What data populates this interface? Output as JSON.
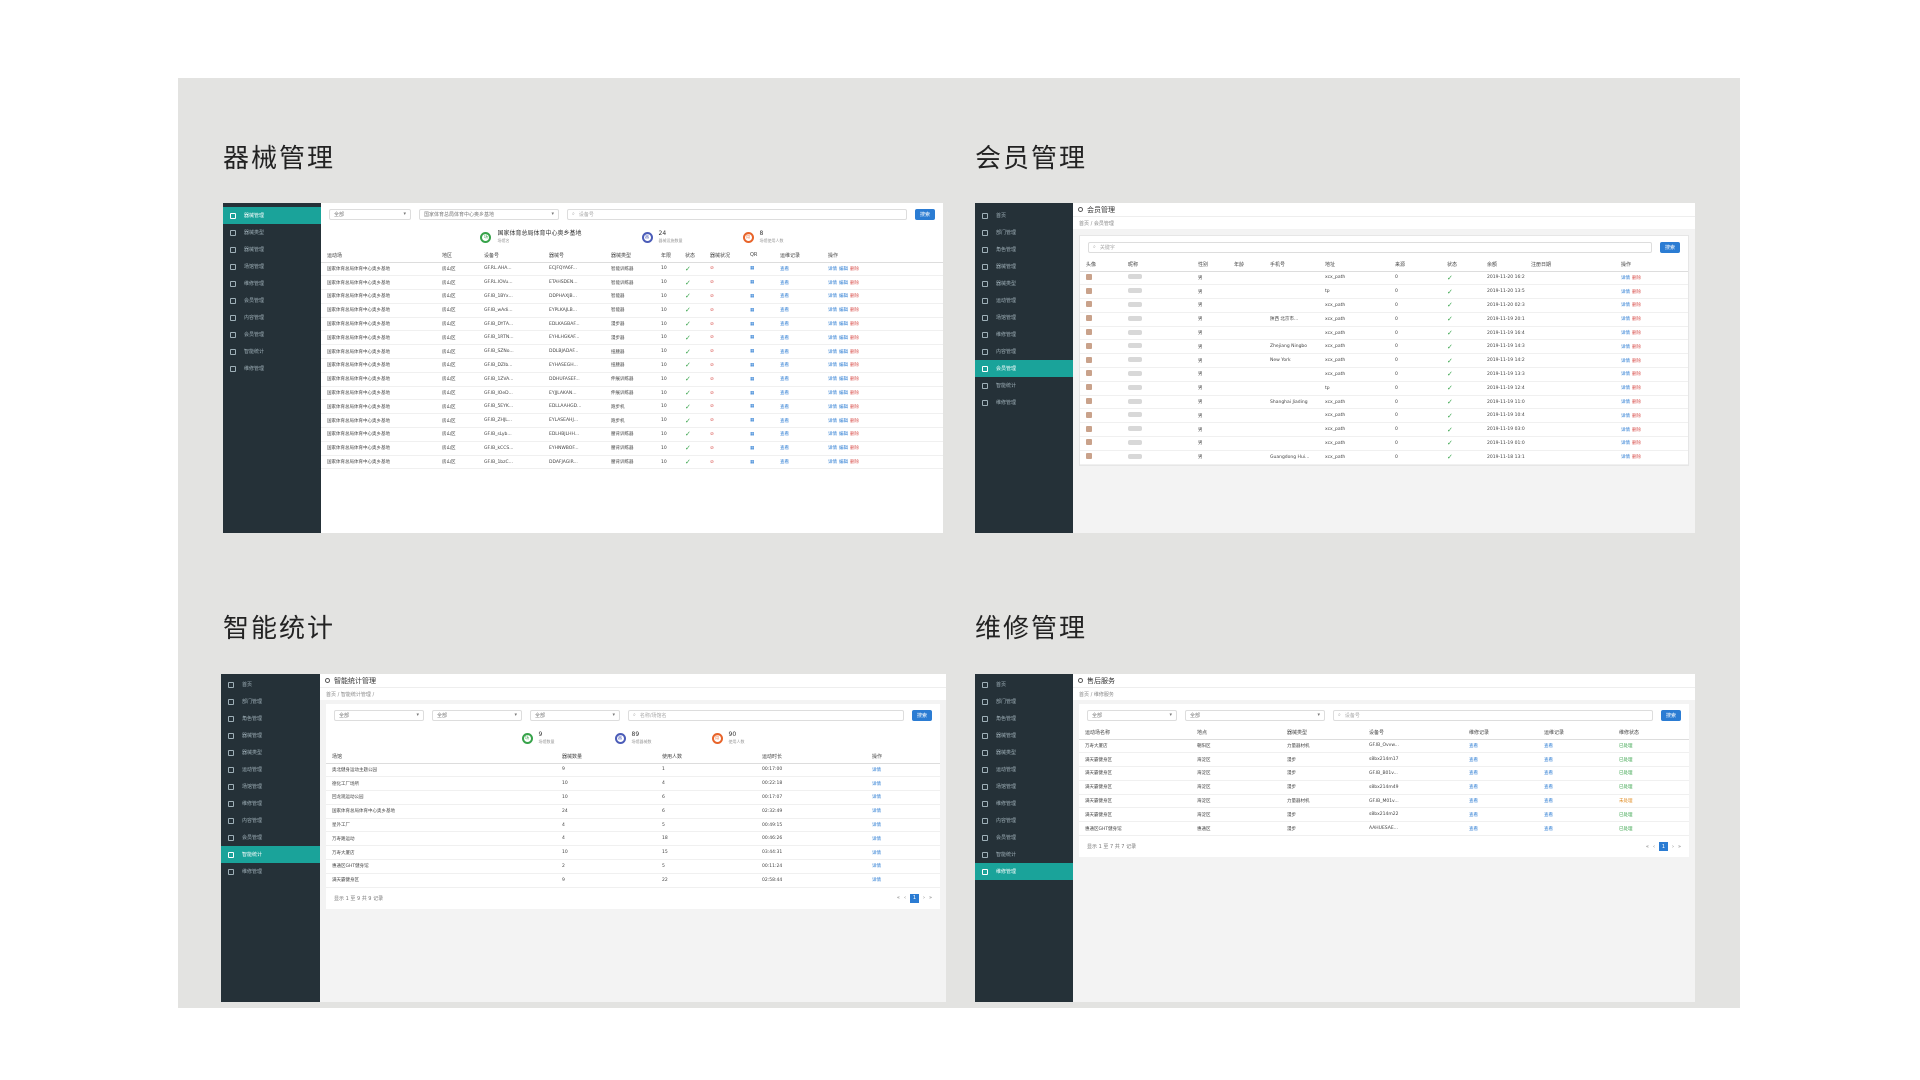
{
  "sections": {
    "equipment": {
      "title": "器械管理"
    },
    "member": {
      "title": "会员管理"
    },
    "stats": {
      "title": "智能统计"
    },
    "repair": {
      "title": "维修管理"
    }
  },
  "equipment": {
    "sidebar": [
      "器械管理",
      "器械类型",
      "器械管理",
      "场馆管理",
      "维修管理",
      "会员管理",
      "内容管理",
      "会员管理",
      "智能统计",
      "维修管理"
    ],
    "filter1": "全部",
    "filter2": "国家体育总局体育中心奥乡基地",
    "search_placeholder": "设备号",
    "search_btn": "搜索",
    "stat1": {
      "icon": "场",
      "value": "国家体育总局体育中心奥乡基地",
      "label": "场馆名"
    },
    "stat2": {
      "icon": "器",
      "value": "24",
      "label": "器械设施数量"
    },
    "stat3": {
      "icon": "用",
      "value": "8",
      "label": "场馆使用人数"
    },
    "columns": [
      "运动场",
      "地区",
      "设备号",
      "器械号",
      "器械类型",
      "年限",
      "状态",
      "器械状况",
      "QR",
      "运维记录",
      "操作"
    ],
    "rows": [
      [
        "国家体育总局体育中心奥乡基地",
        "房山区",
        "GF.RL.AHA...",
        "ECJFQYA6F...",
        "智能训练器",
        "10"
      ],
      [
        "国家体育总局体育中心奥乡基地",
        "房山区",
        "GF.RL.IOVu...",
        "ETAHSDEN...",
        "智能训练器",
        "10"
      ],
      [
        "国家体育总局体育中心奥乡基地",
        "房山区",
        "GF.IB_1BYx...",
        "DDPHAXJB...",
        "智能器",
        "10"
      ],
      [
        "国家体育总局体育中心奥乡基地",
        "房山区",
        "GF.IB_wAdi...",
        "EYPLKAJLB...",
        "智能器",
        "10"
      ],
      [
        "国家体育总局体育中心奥乡基地",
        "房山区",
        "GF.IB_DYTA...",
        "EDLKAGBAF...",
        "漫步器",
        "10"
      ],
      [
        "国家体育总局体育中心奥乡基地",
        "房山区",
        "GF.IB_1RTN...",
        "EYHLHGKAF...",
        "漫步器",
        "10"
      ],
      [
        "国家体育总局体育中心奥乡基地",
        "房山区",
        "GF.IB_SZNo...",
        "DDLBJADAF...",
        "扭腰器",
        "10"
      ],
      [
        "国家体育总局体育中心奥乡基地",
        "房山区",
        "GF.IB_DZIb...",
        "EYHASEGH...",
        "扭腰器",
        "10"
      ],
      [
        "国家体育总局体育中心奥乡基地",
        "房山区",
        "GF.IB_1ZVA...",
        "DDHUFASEF...",
        "伸展训练器",
        "10"
      ],
      [
        "国家体育总局体育中心奥乡基地",
        "房山区",
        "GF.IB_IOeD...",
        "EYJJLAKAN...",
        "伸展训练器",
        "10"
      ],
      [
        "国家体育总局体育中心奥乡基地",
        "房山区",
        "GF.IB_5EYK...",
        "EDLLAAHGD...",
        "跑步机",
        "10"
      ],
      [
        "国家体育总局体育中心奥乡基地",
        "房山区",
        "GF.IB_ZHJL...",
        "EYLASEAHJ...",
        "跑步机",
        "10"
      ],
      [
        "国家体育总局体育中心奥乡基地",
        "房山区",
        "GF.IB_sLyb...",
        "EDLHBJLHH...",
        "腰背训练器",
        "10"
      ],
      [
        "国家体育总局体育中心奥乡基地",
        "房山区",
        "GF.IB_kCCS...",
        "EYHNWBOF...",
        "腰背训练器",
        "10"
      ],
      [
        "国家体育总局体育中心奥乡基地",
        "房山区",
        "GF.IB_1bzC...",
        "DDAFJAGIR...",
        "腰背训练器",
        "10"
      ]
    ],
    "view": "查看",
    "ops": [
      "详情",
      "编辑",
      "删除"
    ]
  },
  "member": {
    "sidebar": [
      "首页",
      "部门管理",
      "角色管理",
      "器械管理",
      "器械类型",
      "运动管理",
      "场馆管理",
      "维修管理",
      "内容管理",
      "会员管理",
      "智能统计",
      "维修管理"
    ],
    "title": "会员管理",
    "crumb": "首页 / 会员管理",
    "search_placeholder": "关键字",
    "search_btn": "搜索",
    "columns": [
      "头像",
      "昵称",
      "性别",
      "年龄",
      "手机号",
      "地址",
      "来源",
      "状态",
      "余额",
      "注册日期",
      "操作"
    ],
    "rows": [
      [
        "男",
        "",
        "",
        "xcx_path",
        "0",
        "2019-11-20 16:23:53"
      ],
      [
        "男",
        "",
        "",
        "tp",
        "0",
        "2019-11-20 13:50:01"
      ],
      [
        "男",
        "",
        "",
        "xcx_path",
        "0",
        "2019-11-20 02:34:27"
      ],
      [
        "男",
        "",
        "陕西 北京市...",
        "xcx_path",
        "0",
        "2019-11-19 20:17:06"
      ],
      [
        "男",
        "",
        "",
        "xcx_path",
        "0",
        "2019-11-19 16:47:44"
      ],
      [
        "男",
        "",
        "Zhejiang Ningbo",
        "xcx_path",
        "0",
        "2019-11-19 14:36:53"
      ],
      [
        "男",
        "",
        "New York",
        "xcx_path",
        "0",
        "2019-11-19 14:28:51"
      ],
      [
        "男",
        "",
        "",
        "xcx_path",
        "0",
        "2019-11-19 13:34:45"
      ],
      [
        "男",
        "",
        "",
        "tp",
        "0",
        "2019-11-19 12:49:20"
      ],
      [
        "男",
        "",
        "Shanghai Jiading",
        "xcx_path",
        "0",
        "2019-11-19 11:02:37"
      ],
      [
        "男",
        "",
        "",
        "xcx_path",
        "0",
        "2019-11-19 10:40:07"
      ],
      [
        "男",
        "",
        "",
        "xcx_path",
        "0",
        "2019-11-19 03:02:00"
      ],
      [
        "男",
        "",
        "",
        "xcx_path",
        "0",
        "2019-11-19 01:03:23"
      ],
      [
        "男",
        "",
        "Guangdong Hui...",
        "xcx_path",
        "0",
        "2019-11-18 13:13:56"
      ]
    ],
    "ops": [
      "详情",
      "删除"
    ]
  },
  "stats": {
    "sidebar": [
      "首页",
      "部门管理",
      "角色管理",
      "器械管理",
      "器械类型",
      "运动管理",
      "场馆管理",
      "维修管理",
      "内容管理",
      "会员管理",
      "智能统计",
      "维修管理"
    ],
    "title": "智能统计管理",
    "crumb": "首页 / 智能统计管理 /",
    "filters": [
      "全部",
      "全部",
      "全部"
    ],
    "search_placeholder": "名称/场馆名",
    "search_btn": "搜索",
    "stat1": {
      "icon": "场",
      "value": "9",
      "label": "场馆数量"
    },
    "stat2": {
      "icon": "器",
      "value": "89",
      "label": "场馆器械数"
    },
    "stat3": {
      "icon": "用",
      "value": "90",
      "label": "使用人数"
    },
    "columns": [
      "场馆",
      "器械数量",
      "使用人数",
      "运动时长",
      "操作"
    ],
    "rows": [
      [
        "奥北健身运动主题公园",
        "9",
        "1",
        "00:17:00"
      ],
      [
        "德化工厂场所",
        "10",
        "4",
        "00:22:18"
      ],
      [
        "回龙观运动公园",
        "10",
        "6",
        "00:17:07"
      ],
      [
        "国家体育总局体育中心奥乡基地",
        "24",
        "6",
        "02:32:49"
      ],
      [
        "星外工厂",
        "4",
        "5",
        "00:49:15"
      ],
      [
        "万寿路运动",
        "4",
        "18",
        "00:46:26"
      ],
      [
        "万寿大厦店",
        "10",
        "15",
        "03:44:31"
      ],
      [
        "惠通区GHT健身馆",
        "2",
        "5",
        "00:11:24"
      ],
      [
        "满天霸健身区",
        "9",
        "22",
        "02:58:44"
      ]
    ],
    "view": "详情",
    "footer": "显示 1 至 9 共 9 记录",
    "page": "1"
  },
  "repair": {
    "sidebar": [
      "首页",
      "部门管理",
      "角色管理",
      "器械管理",
      "器械类型",
      "运动管理",
      "场馆管理",
      "维修管理",
      "内容管理",
      "会员管理",
      "智能统计",
      "维修管理"
    ],
    "title": "售后服务",
    "crumb": "首页 / 维修服务",
    "filters": [
      "全部",
      "全部"
    ],
    "search_placeholder": "设备号",
    "search_btn": "搜索",
    "columns": [
      "运动场名称",
      "地点",
      "器械类型",
      "设备号",
      "维修记录",
      "运维记录",
      "维修状态"
    ],
    "rows": [
      [
        "万寿大厦店",
        "朝阳区",
        "力量器材机",
        "GF.IB_Ovvw...",
        "已处理"
      ],
      [
        "满天霸健身区",
        "海淀区",
        "漫步",
        "s8bx214m17",
        "已处理"
      ],
      [
        "满天霸健身区",
        "海淀区",
        "漫步",
        "GF.IB_B01v...",
        "已处理"
      ],
      [
        "满天霸健身区",
        "海淀区",
        "漫步",
        "s8bx214m49",
        "已处理"
      ],
      [
        "满天霸健身区",
        "海淀区",
        "力量器材机",
        "GF.IB_M01v...",
        "未处理"
      ],
      [
        "满天霸健身区",
        "海淀区",
        "漫步",
        "s8bx214m22",
        "已处理"
      ],
      [
        "惠通区GHT健身馆",
        "惠通区",
        "漫步",
        "AAHUESAE...",
        "已处理"
      ]
    ],
    "view": "查看",
    "footer": "显示 1 至 7 共 7 记录",
    "page": "1"
  }
}
